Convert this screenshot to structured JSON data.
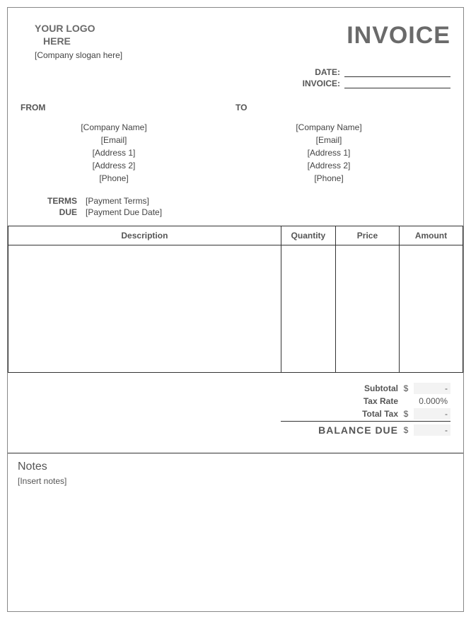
{
  "logo": {
    "line1": "YOUR LOGO",
    "line2": "HERE",
    "slogan": "[Company slogan here]"
  },
  "title": "INVOICE",
  "meta": {
    "date_label": "DATE:",
    "invoice_label": "INVOICE:",
    "date_value": "",
    "invoice_value": ""
  },
  "from": {
    "heading": "FROM",
    "company": "[Company Name]",
    "email": "[Email]",
    "address1": "[Address 1]",
    "address2": "[Address 2]",
    "phone": "[Phone]"
  },
  "to": {
    "heading": "TO",
    "company": "[Company Name]",
    "email": "[Email]",
    "address1": "[Address 1]",
    "address2": "[Address 2]",
    "phone": "[Phone]"
  },
  "terms": {
    "terms_label": "TERMS",
    "terms_value": "[Payment Terms]",
    "due_label": "DUE",
    "due_value": "[Payment Due Date]"
  },
  "columns": {
    "description": "Description",
    "quantity": "Quantity",
    "price": "Price",
    "amount": "Amount"
  },
  "totals": {
    "subtotal_label": "Subtotal",
    "subtotal_currency": "$",
    "subtotal_value": "-",
    "taxrate_label": "Tax Rate",
    "taxrate_value": "0.000%",
    "totaltax_label": "Total Tax",
    "totaltax_currency": "$",
    "totaltax_value": "-",
    "balance_label": "BALANCE  DUE",
    "balance_currency": "$",
    "balance_value": "-"
  },
  "notes": {
    "title": "Notes",
    "body": "[Insert notes]"
  }
}
